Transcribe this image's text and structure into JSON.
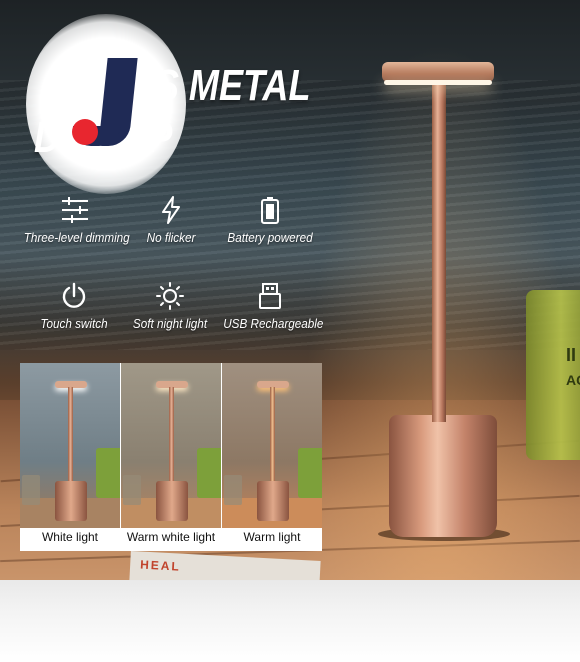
{
  "headline": {
    "line1": "SS METAL",
    "line2": "D LAMP"
  },
  "logo": {
    "icon": "brand-j-logo",
    "colors": {
      "navy": "#1f2a55",
      "red": "#e8262f"
    }
  },
  "features": [
    {
      "icon": "sliders-icon",
      "label": "Three-level dimming"
    },
    {
      "icon": "lightning-icon",
      "label": "No flicker"
    },
    {
      "icon": "battery-icon",
      "label": "Battery powered"
    },
    {
      "icon": "power-icon",
      "label": "Touch switch"
    },
    {
      "icon": "sun-icon",
      "label": "Soft night light"
    },
    {
      "icon": "usb-icon",
      "label": "USB Rechargeable"
    }
  ],
  "light_modes": [
    {
      "label": "White light",
      "color": "#c9d3d8"
    },
    {
      "label": "Warm white light",
      "color": "#d8c4a4"
    },
    {
      "label": "Warm light",
      "color": "#e9a15c"
    }
  ],
  "scene": {
    "jar_label_1": "II",
    "jar_label_2": "AC",
    "magazine_text": "HEAL"
  }
}
